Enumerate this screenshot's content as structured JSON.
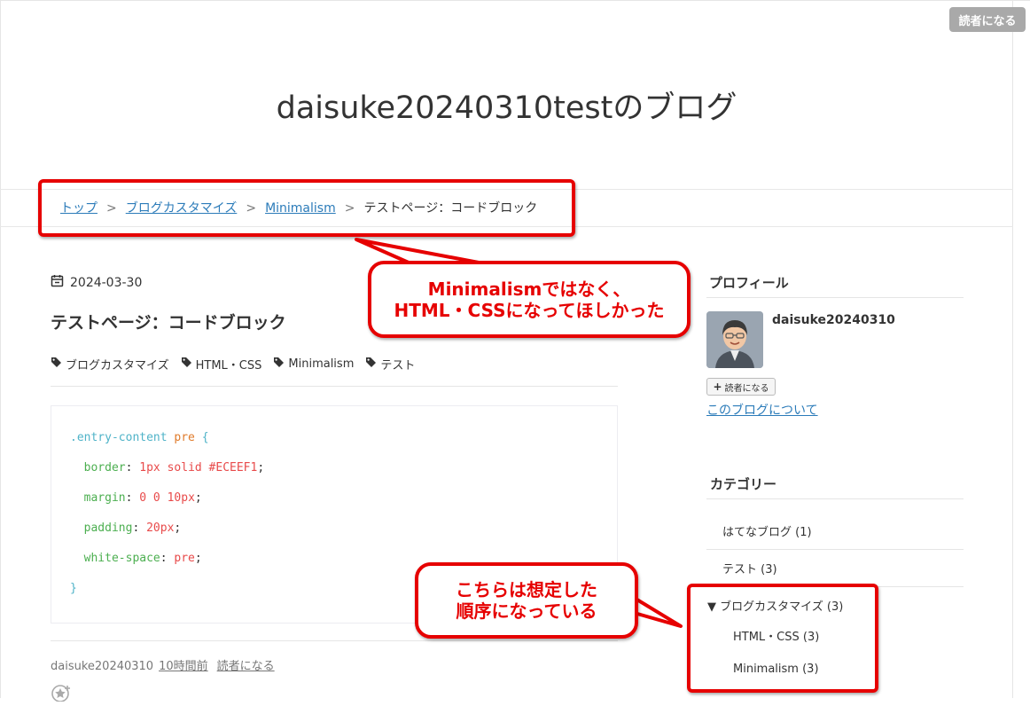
{
  "header": {
    "subscribe_button": "読者になる",
    "blog_title": "daisuke20240310testのブログ"
  },
  "breadcrumb": {
    "items": [
      "トップ",
      "ブログカスタマイズ",
      "Minimalism"
    ],
    "separator": ">",
    "current": "テストページ：コードブロック"
  },
  "entry": {
    "date": "2024-03-30",
    "title": "テストページ：コードブロック",
    "tags": [
      "ブログカスタマイズ",
      "HTML・CSS",
      "Minimalism",
      "テスト"
    ],
    "code": {
      "selector": ".entry-content",
      "selector_tag": "pre",
      "open_brace": "{",
      "close_brace": "}",
      "lines": [
        {
          "prop": "border",
          "value": "1px solid #ECEEF1"
        },
        {
          "prop": "margin",
          "value": "0 0 10px"
        },
        {
          "prop": "padding",
          "value": "20px"
        },
        {
          "prop": "white-space",
          "value": "pre"
        }
      ]
    },
    "footer": {
      "author": "daisuke20240310",
      "time": "10時間前",
      "subscribe": "読者になる"
    }
  },
  "sidebar": {
    "profile": {
      "heading": "プロフィール",
      "name": "daisuke20240310",
      "reader_button": "読者になる",
      "about_link": "このブログについて"
    },
    "categories": {
      "heading": "カテゴリー",
      "items": [
        {
          "label": "はてなブログ (1)"
        },
        {
          "label": "テスト (3)"
        },
        {
          "label": "▼ ブログカスタマイズ (3)"
        }
      ],
      "subitems": [
        {
          "label": "HTML・CSS (3)"
        },
        {
          "label": "Minimalism (3)"
        }
      ]
    }
  },
  "annotations": {
    "callout1_line1": "Minimalismではなく、",
    "callout1_line2": "HTML・CSSになってほしかった",
    "callout2_line1": "こちらは想定した",
    "callout2_line2": "順序になっている"
  },
  "colors": {
    "annotation_red": "#e60000",
    "link_blue": "#2b7bb9"
  }
}
